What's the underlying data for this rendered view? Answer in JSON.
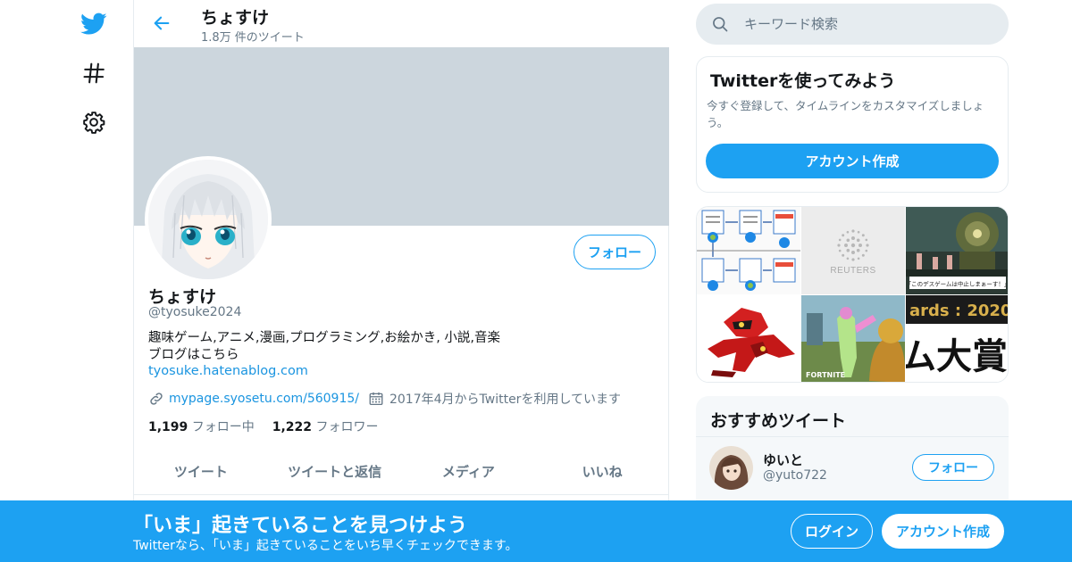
{
  "colors": {
    "accent": "#1da1f2",
    "link": "#1b95e0",
    "secondary_text": "#657786",
    "banner": "#ccd6dd"
  },
  "leftnav": {
    "items": [
      {
        "name": "twitter-logo",
        "icon": "twitter-bird-icon"
      },
      {
        "name": "explore",
        "icon": "hashtag-icon"
      },
      {
        "name": "settings",
        "icon": "gear-icon"
      }
    ]
  },
  "header": {
    "back_icon": "arrow-left-icon",
    "name": "ちょすけ",
    "tweet_count": "1.8万 件のツイート"
  },
  "profile": {
    "follow_label": "フォロー",
    "name": "ちょすけ",
    "handle": "@tyosuke2024",
    "bio_line1": "趣味ゲーム,アニメ,漫画,プログラミング,お絵かき, 小説,音楽",
    "bio_line2": "ブログはこちら",
    "bio_link": "tyosuke.hatenablog.com",
    "website": "mypage.syosetu.com/560915/",
    "joined": "2017年4月からTwitterを利用しています",
    "following_count": "1,199",
    "following_label": "フォロー中",
    "followers_count": "1,222",
    "followers_label": "フォロワー"
  },
  "tabs": [
    "ツイート",
    "ツイートと返信",
    "メディア",
    "いいね"
  ],
  "search": {
    "placeholder": "キーワード検索"
  },
  "signup_card": {
    "title": "Twitterを使ってみよう",
    "description": "今すぐ登録して、タイムラインをカスタマイズしましょう。",
    "button": "アカウント作成"
  },
  "media": {
    "reuters_label": "REUTERS",
    "game_caption": "「このデスゲームは中止しまぁーす！」",
    "awards_text": "ards : 2020",
    "big_text": "ム大賞",
    "fortnite_label": "FORTNITE"
  },
  "recommended": {
    "title": "おすすめツイート",
    "user_name": "ゆいと",
    "user_handle": "@yuto722",
    "follow_label": "フォロー"
  },
  "bottom_bar": {
    "title": "「いま」起きていることを見つけよう",
    "subtitle": "Twitterなら、「いま」起きていることをいち早くチェックできます。",
    "login": "ログイン",
    "signup": "アカウント作成"
  }
}
